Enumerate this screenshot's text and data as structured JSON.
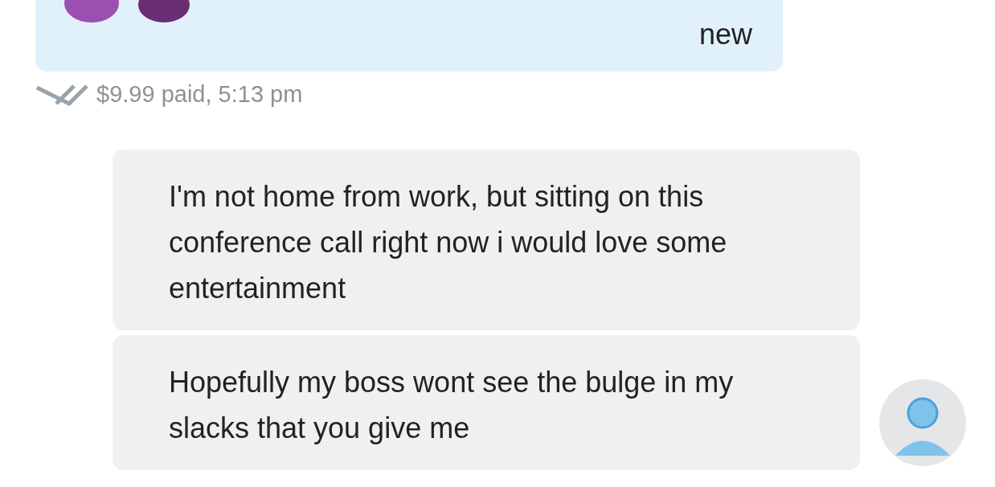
{
  "messages": [
    {
      "kind": "outgoing",
      "text": "new",
      "meta": "$9.99 paid, 5:13 pm",
      "read": true
    },
    {
      "kind": "incoming",
      "text": "I'm not home from work, but sitting on this conference call right now i would love some entertainment"
    },
    {
      "kind": "incoming",
      "text": "Hopefully my boss wont see the bulge in my slacks that you give me"
    }
  ]
}
